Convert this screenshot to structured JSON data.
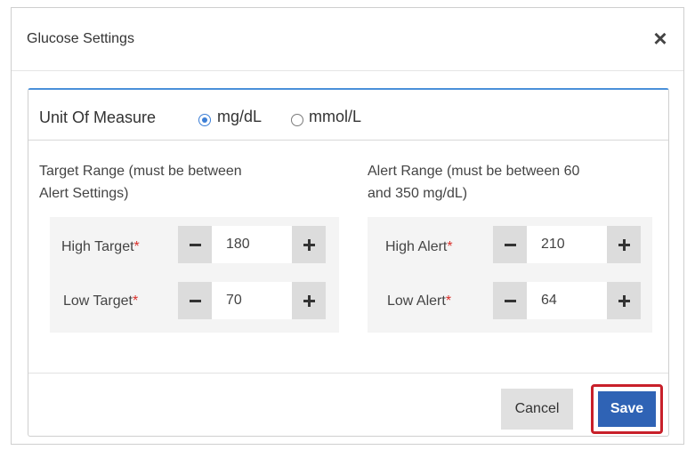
{
  "dialog": {
    "title": "Glucose Settings",
    "close_icon": "close-icon"
  },
  "unit": {
    "label": "Unit Of Measure",
    "options": [
      {
        "label": "mg/dL",
        "selected": true
      },
      {
        "label": "mmol/L",
        "selected": false
      }
    ]
  },
  "target": {
    "description_line1": "Target Range (must be between",
    "description_line2": "Alert Settings)",
    "high": {
      "label": "High Target",
      "value": "180"
    },
    "low": {
      "label": "Low Target",
      "value": "70"
    }
  },
  "alert": {
    "description_line1": "Alert Range (must be between 60",
    "description_line2": "and 350 mg/dL)",
    "high": {
      "label": "High Alert",
      "value": "210"
    },
    "low": {
      "label": "Low Alert",
      "value": "64"
    }
  },
  "required_marker": "*",
  "buttons": {
    "cancel": "Cancel",
    "save": "Save"
  },
  "colors": {
    "accent": "#2f63b5",
    "highlight": "#c8202a",
    "required": "#d9302b",
    "panel_top": "#4a90d9"
  }
}
